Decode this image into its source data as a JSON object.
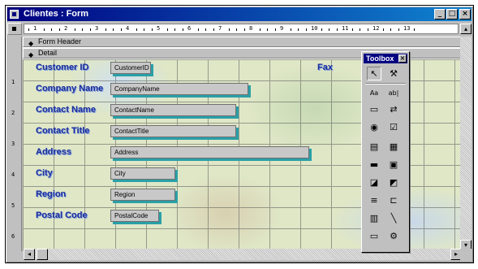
{
  "window": {
    "title": "Clientes : Form",
    "minimize": "_",
    "maximize": "□",
    "close": "×"
  },
  "ruler": {
    "numbers": [
      "1",
      "2",
      "3",
      "4",
      "5",
      "6",
      "7",
      "8",
      "9",
      "10",
      "11",
      "12",
      "13"
    ],
    "vertical_numbers": [
      "1",
      "2",
      "3",
      "4",
      "5",
      "6"
    ]
  },
  "sections": {
    "form_header": "Form Header",
    "detail": "Detail"
  },
  "fields": [
    {
      "label": "Customer ID",
      "control": "CustomerID"
    },
    {
      "label": "Company Name",
      "control": "CompanyName"
    },
    {
      "label": "Contact Name",
      "control": "ContactName"
    },
    {
      "label": "Contact Title",
      "control": "ContactTitle"
    },
    {
      "label": "Address",
      "control": "Address"
    },
    {
      "label": "City",
      "control": "City"
    },
    {
      "label": "Region",
      "control": "Region"
    },
    {
      "label": "Postal Code",
      "control": "PostalCode"
    }
  ],
  "fax_label": "Fax",
  "toolbox": {
    "title": "Toolbox",
    "close": "×",
    "tools": [
      {
        "name": "select-objects-icon",
        "glyph": "↖"
      },
      {
        "name": "control-wizards-icon",
        "glyph": "⚒"
      },
      {
        "name": "label-tool-icon",
        "glyph": "Aa"
      },
      {
        "name": "textbox-tool-icon",
        "glyph": "ab|"
      },
      {
        "name": "option-group-icon",
        "glyph": "▭"
      },
      {
        "name": "toggle-button-icon",
        "glyph": "⇄"
      },
      {
        "name": "option-button-icon",
        "glyph": "◉"
      },
      {
        "name": "checkbox-icon",
        "glyph": "☑"
      },
      {
        "name": "combo-box-icon",
        "glyph": "▤"
      },
      {
        "name": "list-box-icon",
        "glyph": "▦"
      },
      {
        "name": "command-button-icon",
        "glyph": "▬"
      },
      {
        "name": "image-tool-icon",
        "glyph": "▣"
      },
      {
        "name": "unbound-object-frame-icon",
        "glyph": "◪"
      },
      {
        "name": "bound-object-frame-icon",
        "glyph": "◩"
      },
      {
        "name": "page-break-icon",
        "glyph": "≡"
      },
      {
        "name": "tab-control-icon",
        "glyph": "⊏"
      },
      {
        "name": "subform-icon",
        "glyph": "▥"
      },
      {
        "name": "line-tool-icon",
        "glyph": "╲"
      },
      {
        "name": "rectangle-tool-icon",
        "glyph": "▭"
      },
      {
        "name": "more-controls-icon",
        "glyph": "⚙"
      }
    ]
  },
  "scroll": {
    "left": "◂",
    "right": "▸",
    "up": "▴",
    "down": "▾"
  },
  "colors": {
    "title_bar": "#000080",
    "label_text": "#1c2c9a",
    "control_shadow": "#2aa0a8"
  }
}
